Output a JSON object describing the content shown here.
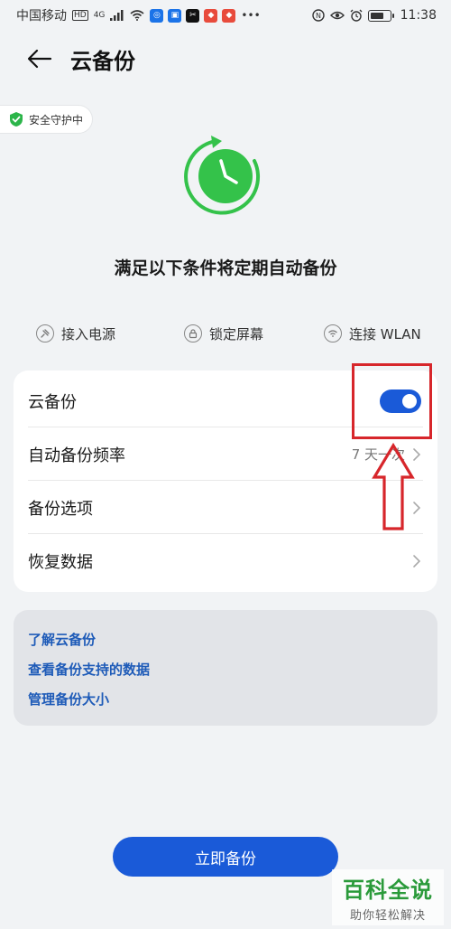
{
  "status_bar": {
    "carrier": "中国移动",
    "hd": "HD",
    "network": "4G",
    "time": "11:38",
    "app_badges": [
      {
        "name": "app-badge-1",
        "color": "#1b73e8",
        "glyph": "◎"
      },
      {
        "name": "app-badge-2",
        "color": "#1b73e8",
        "glyph": "▣"
      },
      {
        "name": "app-badge-3",
        "color": "#111111",
        "glyph": "✂"
      },
      {
        "name": "app-badge-4",
        "color": "#e84b3c",
        "glyph": "◆"
      },
      {
        "name": "app-badge-5",
        "color": "#e84b3c",
        "glyph": "◆"
      }
    ]
  },
  "header": {
    "title": "云备份"
  },
  "security": {
    "label": "安全守护中"
  },
  "hero": {
    "caption": "满足以下条件将定期自动备份"
  },
  "conditions": [
    {
      "label": "接入电源",
      "icon": "power-plug-icon"
    },
    {
      "label": "锁定屏幕",
      "icon": "lock-icon"
    },
    {
      "label": "连接 WLAN",
      "icon": "wifi-icon"
    }
  ],
  "settings": {
    "cloud_backup": {
      "label": "云备份",
      "enabled": true
    },
    "frequency": {
      "label": "自动备份频率",
      "value": "7 天一次"
    },
    "options": {
      "label": "备份选项"
    },
    "restore": {
      "label": "恢复数据"
    }
  },
  "links": [
    "了解云备份",
    "查看备份支持的数据",
    "管理备份大小"
  ],
  "primary_button": {
    "label": "立即备份"
  },
  "watermark": {
    "main": "百科全说",
    "sub": "助你轻松解决"
  },
  "colors": {
    "accent": "#1a5ad8",
    "link": "#1e5bb8",
    "hero_green": "#34c24a",
    "annotation_red": "#d7262b"
  }
}
